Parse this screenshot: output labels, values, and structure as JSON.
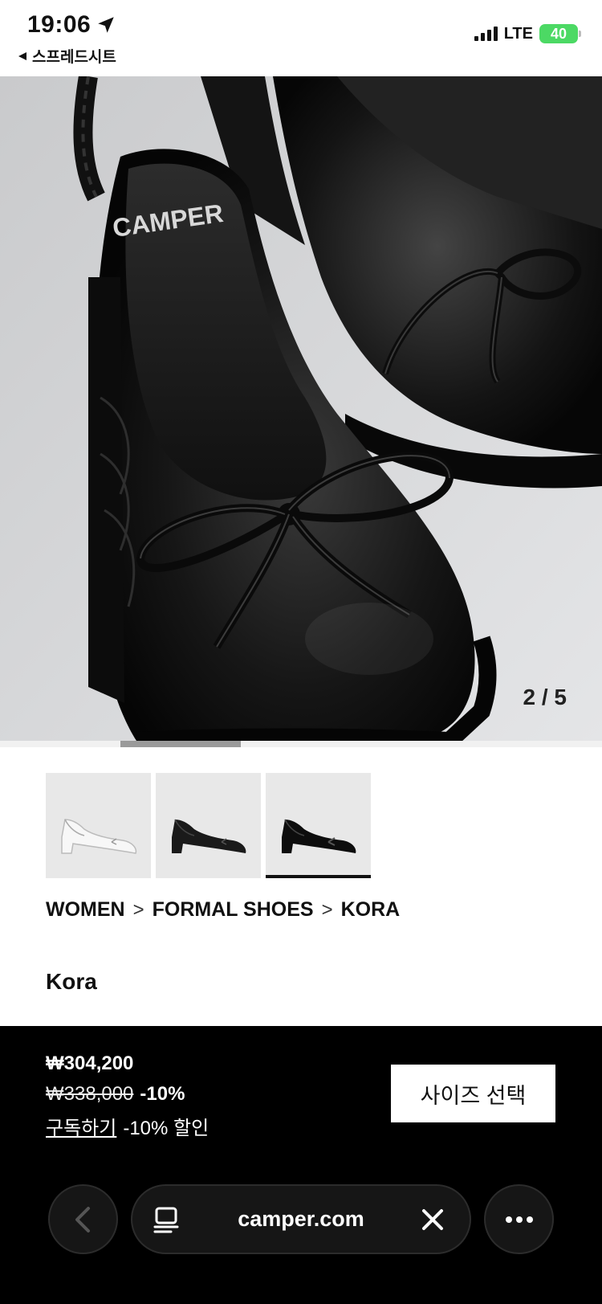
{
  "status": {
    "time": "19:06",
    "back_app": "스프레드시트",
    "network": "LTE",
    "battery": "40"
  },
  "hero": {
    "counter": "2 / 5",
    "brand_text": "CAMPER",
    "slide_index": 2,
    "slide_total": 5
  },
  "thumbnails": [
    {
      "name": "white-shoe",
      "color": "#f2f2f2"
    },
    {
      "name": "black-shoe",
      "color": "#1a1a1a"
    },
    {
      "name": "black-shoe-bow",
      "color": "#111111"
    }
  ],
  "breadcrumb": {
    "items": [
      "WOMEN",
      "FORMAL SHOES",
      "KORA"
    ],
    "separator": ">"
  },
  "product": {
    "name": "Kora"
  },
  "pricing": {
    "price": "₩304,200",
    "original_price": "₩338,000",
    "discount": "-10%",
    "subscribe_link": "구독하기",
    "subscribe_text": "-10% 할인",
    "size_button": "사이즈 선택"
  },
  "browser": {
    "url": "camper.com"
  }
}
